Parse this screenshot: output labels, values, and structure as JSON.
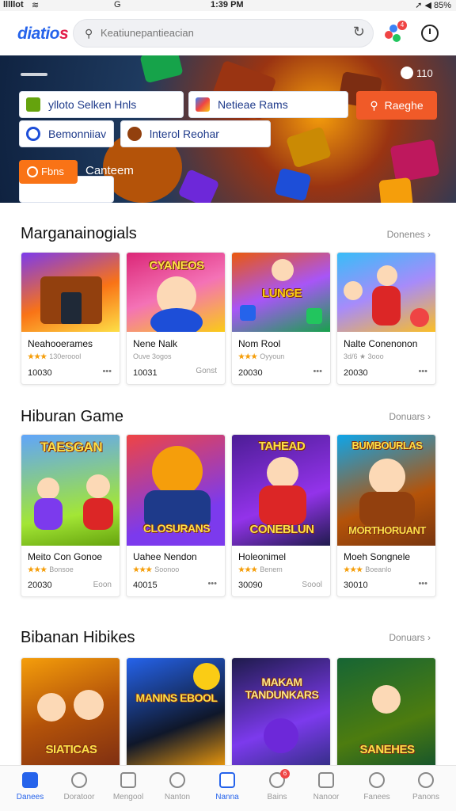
{
  "status_bar": {
    "carrier": "lllllot",
    "signal": "≋",
    "g": "G",
    "time": "1:39 PM",
    "right": "➚ ◀ 85%"
  },
  "app_bar": {
    "logo_part1": "diatio",
    "logo_part2": "s",
    "search_placeholder": "Keatiunepantieacian",
    "notification_count": "4"
  },
  "hero": {
    "counter": "110",
    "chips": [
      {
        "label": "ylloto Selken Hnls"
      },
      {
        "label": "Netieae Rams"
      },
      {
        "label": "Bemonniiav"
      },
      {
        "label": "lnterol Reohar"
      }
    ],
    "search_button": "Raeghe",
    "filter_button": "Fbns",
    "tagline": "Canteem"
  },
  "sections": [
    {
      "title": "Marganainogials",
      "more": "Donenes ›",
      "cards": [
        {
          "name": "Neahooerames",
          "rating": "★★★",
          "rating_text": "130eroool",
          "price": "10030",
          "art_title": ""
        },
        {
          "name": "Nene Nalk",
          "rating": "",
          "rating_text": "Ouve 3ogos",
          "price": "10031",
          "art_title": "CYANEOS",
          "extra": "Gonst"
        },
        {
          "name": "Nom Rool",
          "rating": "★★★",
          "rating_text": "Oyyoun",
          "price": "20030",
          "art_title": "LUNGE"
        },
        {
          "name": "Nalte Conenonon",
          "rating": "",
          "rating_text": "3d/6 ★ 3ooo",
          "price": "20030",
          "art_title": ""
        }
      ]
    },
    {
      "title": "Hiburan Game",
      "more": "Donuars ›",
      "cards": [
        {
          "name": "Meito Con Gonoe",
          "rating": "★★★",
          "rating_text": "Bonsoe",
          "price": "20030",
          "art_title": "TAESGAN",
          "extra": "Eoon"
        },
        {
          "name": "Uahee Nendon",
          "rating": "★★★",
          "rating_text": "Soonoo",
          "price": "40015",
          "art_title": "CLOSURANS"
        },
        {
          "name": "Holeonimel",
          "rating": "★★★",
          "rating_text": "Benem",
          "price": "30090",
          "art_title": "CONEBLUN",
          "extra": "Soool"
        },
        {
          "name": "Moeh Songnele",
          "rating": "★★★",
          "rating_text": "Boeanlo",
          "price": "30010",
          "art_title": "MORTHORUANT"
        }
      ]
    },
    {
      "title": "Bibanan Hibikes",
      "more": "Donuars ›",
      "cards": [
        {
          "art_title": "SIATICAS"
        },
        {
          "art_title": "MANINS EBOOL"
        },
        {
          "art_title": "MAKAM TANDUNKARS"
        },
        {
          "art_title": "SANEHES"
        }
      ]
    }
  ],
  "tab_bar": [
    {
      "label": "Danees",
      "active": true
    },
    {
      "label": "Doratoor"
    },
    {
      "label": "Mengool"
    },
    {
      "label": "Nanton"
    },
    {
      "label": "Nanna"
    },
    {
      "label": "Bains",
      "badge": "6"
    },
    {
      "label": "Nanoor"
    },
    {
      "label": "Fanees"
    },
    {
      "label": "Panons"
    }
  ],
  "colors": {
    "accent": "#2563eb",
    "cta": "#f05a28",
    "star": "#f59e0b"
  }
}
